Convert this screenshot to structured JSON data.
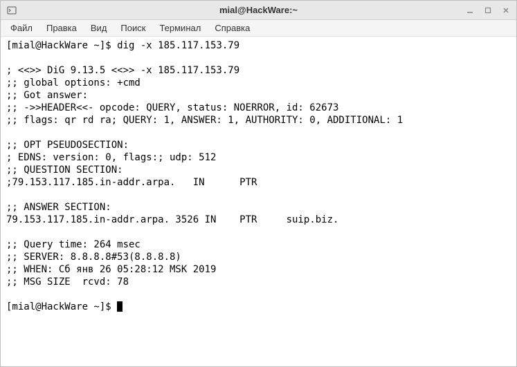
{
  "window": {
    "title": "mial@HackWare:~"
  },
  "menu": {
    "file": "Файл",
    "edit": "Правка",
    "view": "Вид",
    "search": "Поиск",
    "terminal": "Терминал",
    "help": "Справка"
  },
  "terminal": {
    "prompt1": "[mial@HackWare ~]$ ",
    "command": "dig -x 185.117.153.79",
    "blank1": "",
    "l1": "; <<>> DiG 9.13.5 <<>> -x 185.117.153.79",
    "l2": ";; global options: +cmd",
    "l3": ";; Got answer:",
    "l4": ";; ->>HEADER<<- opcode: QUERY, status: NOERROR, id: 62673",
    "l5": ";; flags: qr rd ra; QUERY: 1, ANSWER: 1, AUTHORITY: 0, ADDITIONAL: 1",
    "blank2": "",
    "l6": ";; OPT PSEUDOSECTION:",
    "l7": "; EDNS: version: 0, flags:; udp: 512",
    "l8": ";; QUESTION SECTION:",
    "l9": ";79.153.117.185.in-addr.arpa.   IN      PTR",
    "blank3": "",
    "l10": ";; ANSWER SECTION:",
    "l11": "79.153.117.185.in-addr.arpa. 3526 IN    PTR     suip.biz.",
    "blank4": "",
    "l12": ";; Query time: 264 msec",
    "l13": ";; SERVER: 8.8.8.8#53(8.8.8.8)",
    "l14": ";; WHEN: Сб янв 26 05:28:12 MSK 2019",
    "l15": ";; MSG SIZE  rcvd: 78",
    "blank5": "",
    "prompt2": "[mial@HackWare ~]$ "
  }
}
